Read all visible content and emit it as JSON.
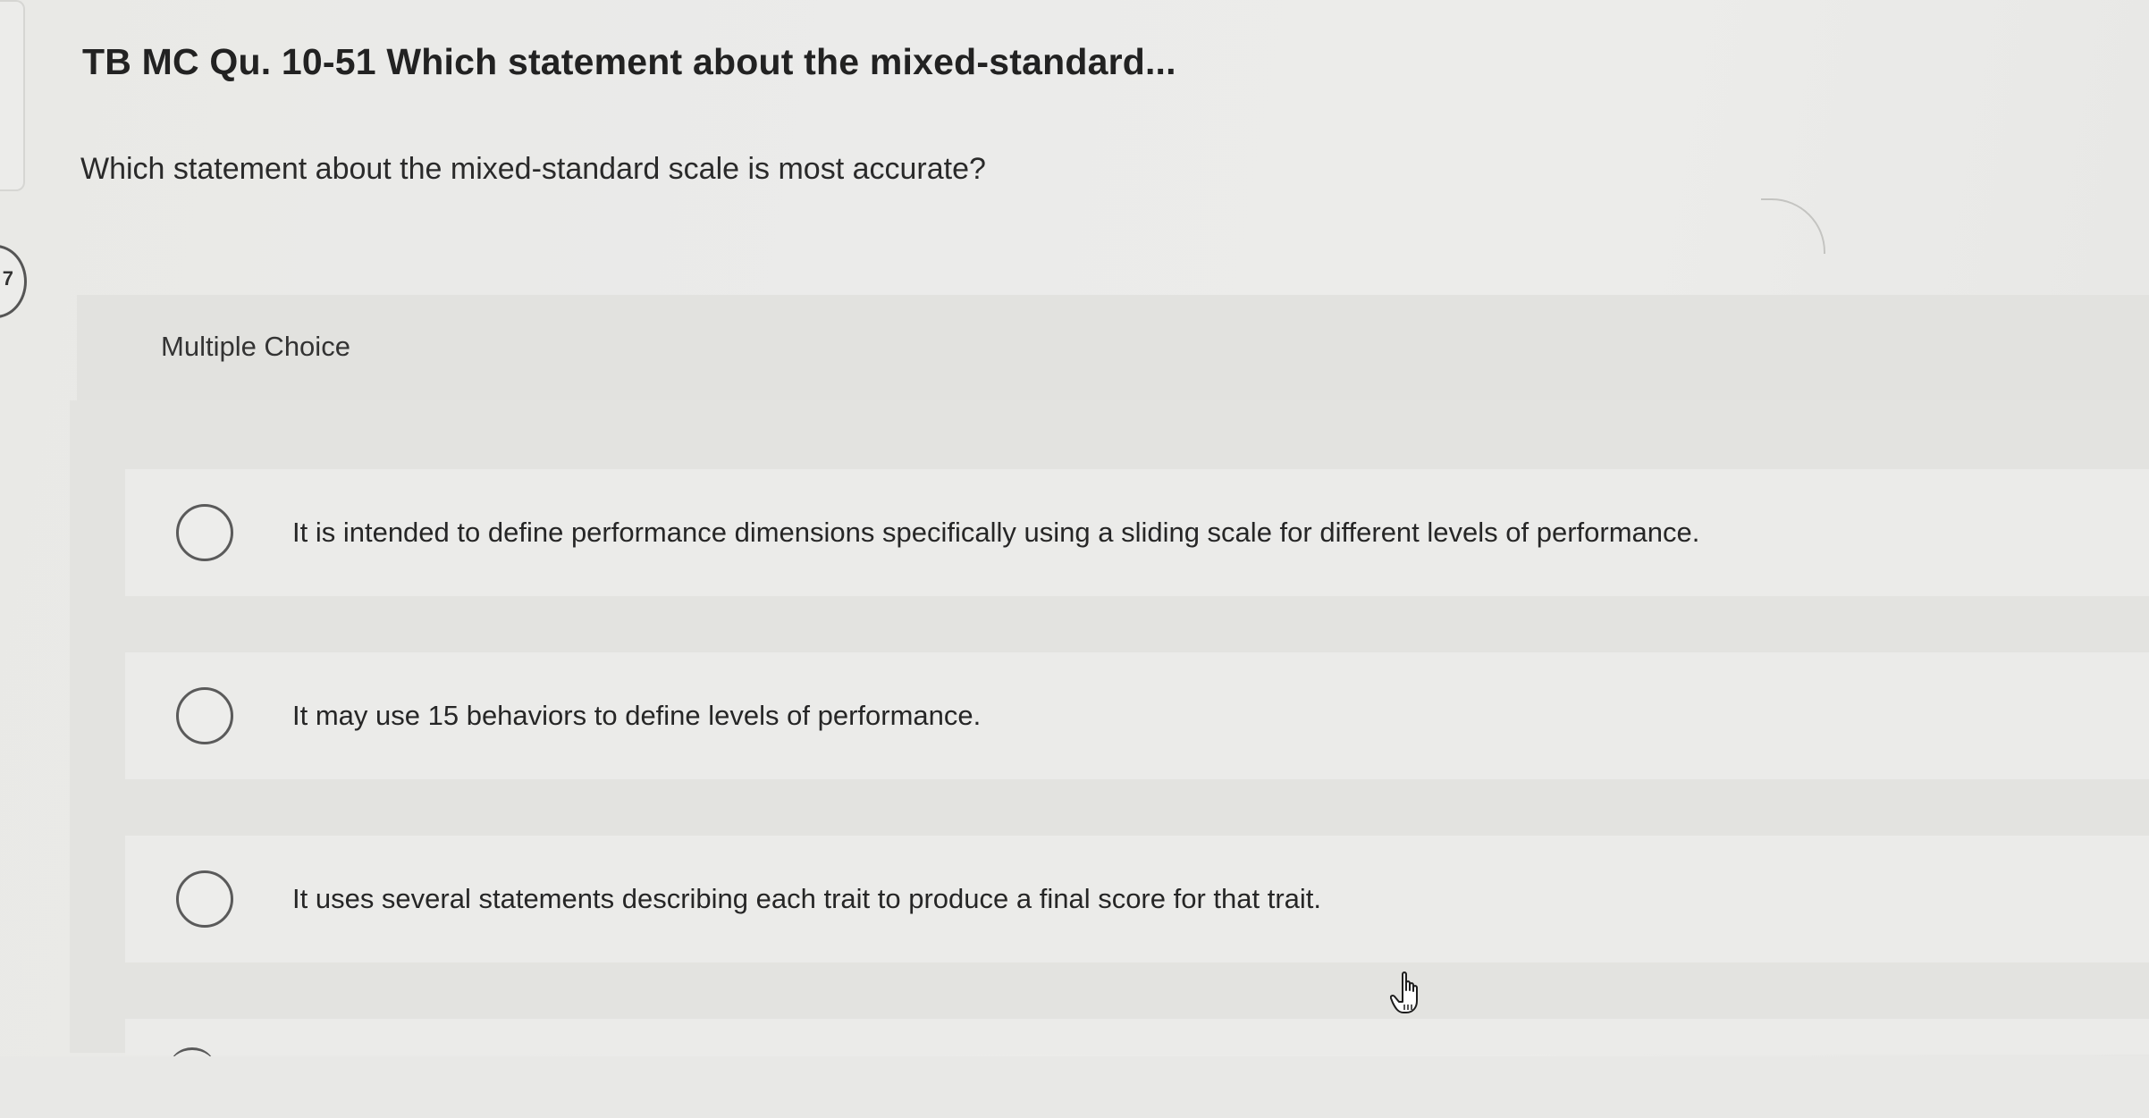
{
  "question": {
    "title": "TB MC Qu. 10-51 Which statement about the mixed-standard...",
    "prompt": "Which statement about the mixed-standard scale is most accurate?",
    "type_label": "Multiple Choice"
  },
  "choices": [
    {
      "text": "It is intended to define performance dimensions specifically using a sliding scale for different levels of performance.",
      "selected": false
    },
    {
      "text": "It may use 15 behaviors to define levels of performance.",
      "selected": false
    },
    {
      "text": "It uses several statements describing each trait to produce a final score for that trait.",
      "selected": false
    }
  ],
  "left_rail": {
    "item_number": "7"
  },
  "cursor": {
    "icon": "hand-pointer-icon"
  },
  "colors": {
    "background": "#ebebe9",
    "header_band": "#e2e2df",
    "radio_border": "#5a5a5a",
    "text": "#262626"
  }
}
